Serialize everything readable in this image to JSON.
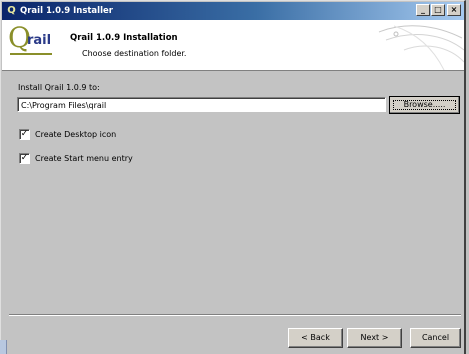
{
  "window": {
    "title": "Qrail 1.0.9 Installer",
    "icon_glyph": "Q",
    "controls": {
      "minimize": "_",
      "maximize": "□",
      "close": "×"
    }
  },
  "header": {
    "logo_q": "Q",
    "logo_rail": "rail",
    "title": "Qrail 1.0.9 Installation",
    "subtitle": "Choose destination folder."
  },
  "main": {
    "install_label": "Install Qrail 1.0.9 to:",
    "path_value": "C:\\Program Files\\qrail",
    "browse_label": "Browse.....",
    "options": [
      {
        "label": "Create Desktop icon",
        "checked": true,
        "mark": "✓"
      },
      {
        "label": "Create Start menu entry",
        "checked": true,
        "mark": "✓"
      }
    ]
  },
  "footer": {
    "back_label": "< Back",
    "next_label": "Next >",
    "cancel_label": "Cancel"
  },
  "colors": {
    "title_gradient_start": "#0a246a",
    "title_gradient_end": "#a6caf0",
    "dialog_bg": "#c3c3c3",
    "logo_green": "#8a8f2a",
    "logo_blue": "#2a3a88"
  }
}
